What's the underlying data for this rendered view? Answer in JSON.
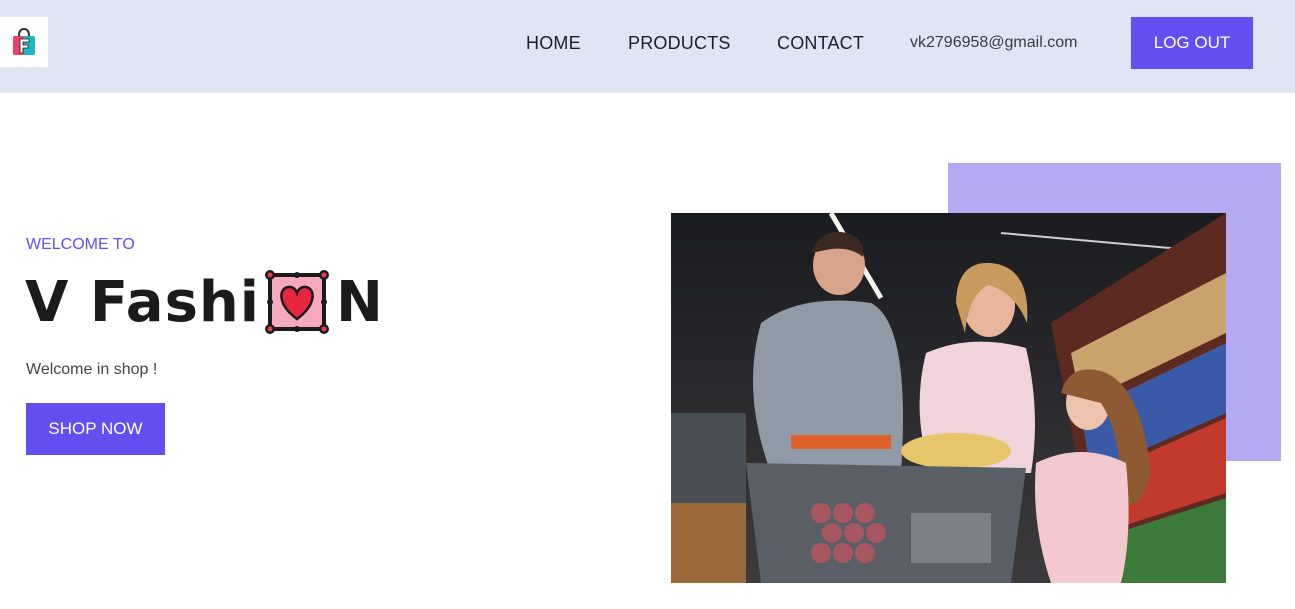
{
  "header": {
    "logo_icon": "shopping-bag-logo-icon",
    "nav": {
      "home": "HOME",
      "products": "PRODUCTS",
      "contact": "CONTACT"
    },
    "user_email": "vk2796958@gmail.com",
    "logout_label": "LOG OUT"
  },
  "hero": {
    "eyebrow": "WELCOME TO",
    "title_prefix": "V Fashi",
    "title_icon": "heart-frame-emoji-icon",
    "title_suffix": "N",
    "subtitle": "Welcome in shop !",
    "cta_label": "SHOP NOW",
    "image_icon": "family-grocery-shopping-photo"
  },
  "colors": {
    "accent": "#634ff0",
    "accent_light": "#b4aaf4",
    "navbar_bg": "#dfe6f3"
  }
}
